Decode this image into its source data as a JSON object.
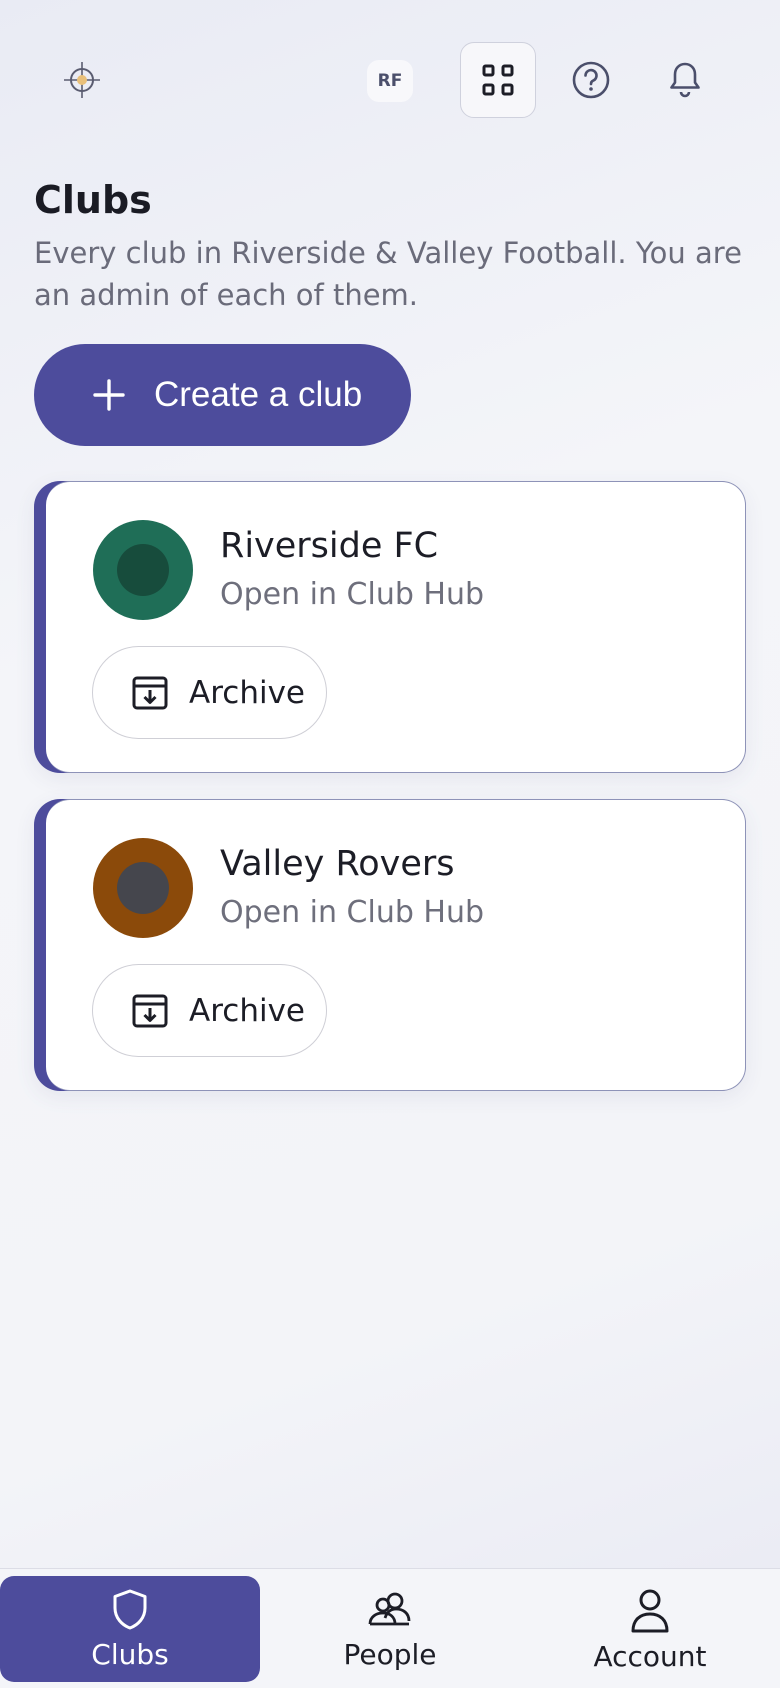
{
  "header": {
    "user_initials": "RF",
    "icons": [
      "app-logo-icon",
      "apps-grid-icon",
      "help-icon",
      "bell-icon"
    ]
  },
  "page": {
    "title": "Clubs",
    "subtitle": "Every club in Riverside & Valley Football. You are an admin of each of them."
  },
  "create_button": {
    "label": "Create a club"
  },
  "clubs": [
    {
      "name": "Riverside FC",
      "link_text": "Open in Club Hub",
      "archive_label": "Archive",
      "ring_color": "#1f6e57",
      "core_color": "#174c3c"
    },
    {
      "name": "Valley Rovers",
      "link_text": "Open in Club Hub",
      "archive_label": "Archive",
      "ring_color": "#8b4a0a",
      "core_color": "#45464d"
    }
  ],
  "bottom_nav": {
    "active": "Clubs",
    "items": [
      {
        "label": "Clubs",
        "icon": "shield-icon"
      },
      {
        "label": "People",
        "icon": "people-icon"
      },
      {
        "label": "Account",
        "icon": "person-icon"
      }
    ]
  },
  "colors": {
    "accent": "#4d4c9c",
    "text": "#1c1d26",
    "muted": "#6e6f7c"
  }
}
